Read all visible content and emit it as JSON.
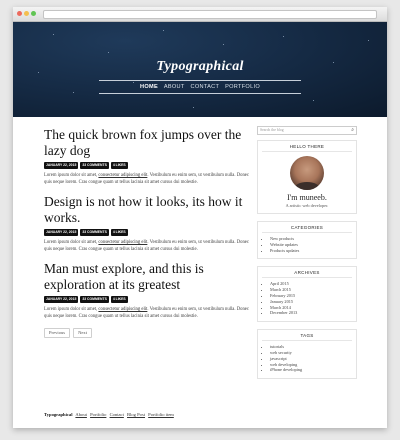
{
  "site": {
    "title": "Typographical",
    "nav": [
      "HOME",
      "ABOUT",
      "CONTACT",
      "PORTFOLIO"
    ]
  },
  "posts": [
    {
      "title": "The quick brown fox jumps over the lazy dog",
      "date": "JANUARY 22, 2015",
      "comments": "33 COMMENTS",
      "likes": "4 LIKES",
      "excerpt_start": "Lorem ipsum dolor sit amet, ",
      "excerpt_link": "consectetur adipiscing elit",
      "excerpt_end": ". Vestibulum eu enim sem, ut vestibulum nulla. Donec quis neque lorem. Cras congue quam ut tellus lacinia sit amet cursus dui molestie."
    },
    {
      "title": "Design is not how it looks, its how it works.",
      "date": "JANUARY 22, 2015",
      "comments": "33 COMMENTS",
      "likes": "4 LIKES",
      "excerpt_start": "Lorem ipsum dolor sit amet, ",
      "excerpt_link": "consectetur adipiscing elit",
      "excerpt_end": ". Vestibulum eu enim sem, ut vestibulum nulla. Donec quis neque lorem. Cras congue quam ut tellus lacinia sit amet cursus dui molestie."
    },
    {
      "title": "Man must explore, and this is exploration at its greatest",
      "date": "JANUARY 22, 2015",
      "comments": "33 COMMENTS",
      "likes": "4 LIKES",
      "excerpt_start": "Lorem ipsum dolor sit amet, ",
      "excerpt_link": "consectetur adipiscing elit",
      "excerpt_end": ". Vestibulum eu enim sem, ut vestibulum nulla. Donec quis neque lorem. Cras congue quam ut tellus lacinia sit amet cursus dui molestie."
    }
  ],
  "pager": {
    "previous": "Previous",
    "next": "Next"
  },
  "sidebar": {
    "search_placeholder": "Search the blog",
    "about": {
      "title": "HELLO THERE",
      "name": "I'm muneeb.",
      "bio": "A artistic web developer."
    },
    "categories": {
      "title": "CATEGORIES",
      "items": [
        "New products",
        "Website updates",
        "Products updates"
      ]
    },
    "archives": {
      "title": "ARCHIVES",
      "items": [
        "April 2015",
        "March 2015",
        "February 2015",
        "January 2015",
        "March 2014",
        "December 2013"
      ]
    },
    "tags": {
      "title": "TAGS",
      "items": [
        "tutorials",
        "web security",
        "javascript",
        "web developing",
        "iPhone developing"
      ]
    }
  },
  "footer": {
    "brand": "Typographical",
    "links": [
      "About",
      "Portfolio",
      "Contact",
      "Blog Post",
      "Portfolio item"
    ]
  },
  "colors": {
    "hero": "#152a44",
    "badge": "#111111"
  }
}
